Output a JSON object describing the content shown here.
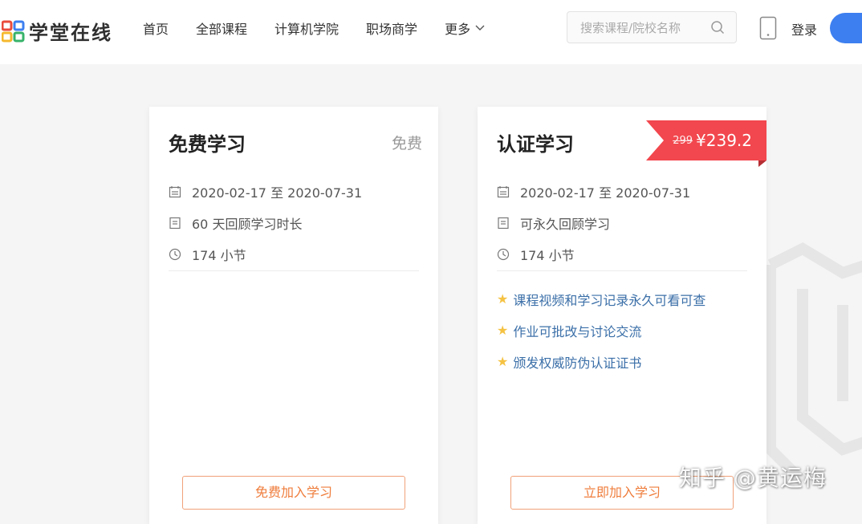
{
  "header": {
    "brand": "学堂在线",
    "nav": [
      "首页",
      "全部课程",
      "计算机学院",
      "职场商学",
      "更多"
    ],
    "search_placeholder": "搜索课程/院校名称",
    "login": "登录"
  },
  "cards": {
    "free": {
      "title": "免费学习",
      "tag": "免费",
      "date": "2020-02-17 至 2020-07-31",
      "review": "60 天回顾学习时长",
      "sections": "174 小节",
      "button": "免费加入学习"
    },
    "cert": {
      "title": "认证学习",
      "old_price": "299",
      "price": "¥239.2",
      "date": "2020-02-17 至 2020-07-31",
      "review": "可永久回顾学习",
      "sections": "174 小节",
      "features": [
        "课程视频和学习记录永久可看可查",
        "作业可批改与讨论交流",
        "颁发权威防伪认证证书"
      ],
      "button": "立即加入学习"
    }
  },
  "watermark": {
    "text": "知乎 @黄运梅"
  },
  "colors": {
    "accent_blue": "#3d7ff0",
    "price_red": "#f2474e",
    "button_orange": "#ef7d3c",
    "feature_blue": "#3b6fa8",
    "star_yellow": "#f5c242"
  }
}
